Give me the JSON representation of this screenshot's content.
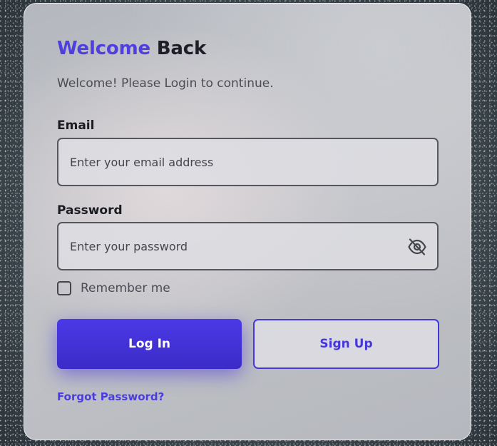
{
  "header": {
    "title_accent": "Welcome",
    "title_rest": "Back",
    "subtitle": "Welcome! Please Login to continue."
  },
  "email": {
    "label": "Email",
    "placeholder": "Enter your email address",
    "value": ""
  },
  "password": {
    "label": "Password",
    "placeholder": "Enter your password",
    "value": "",
    "toggle_icon": "eye-off-icon"
  },
  "remember": {
    "label": "Remember me",
    "checked": false
  },
  "actions": {
    "login_label": "Log In",
    "signup_label": "Sign Up",
    "forgot_label": "Forgot Password?"
  },
  "colors": {
    "accent": "#4f3fe0",
    "primary_button": "#4232d6",
    "text_dark": "#1e1f26",
    "text_muted": "#4b4c54"
  }
}
